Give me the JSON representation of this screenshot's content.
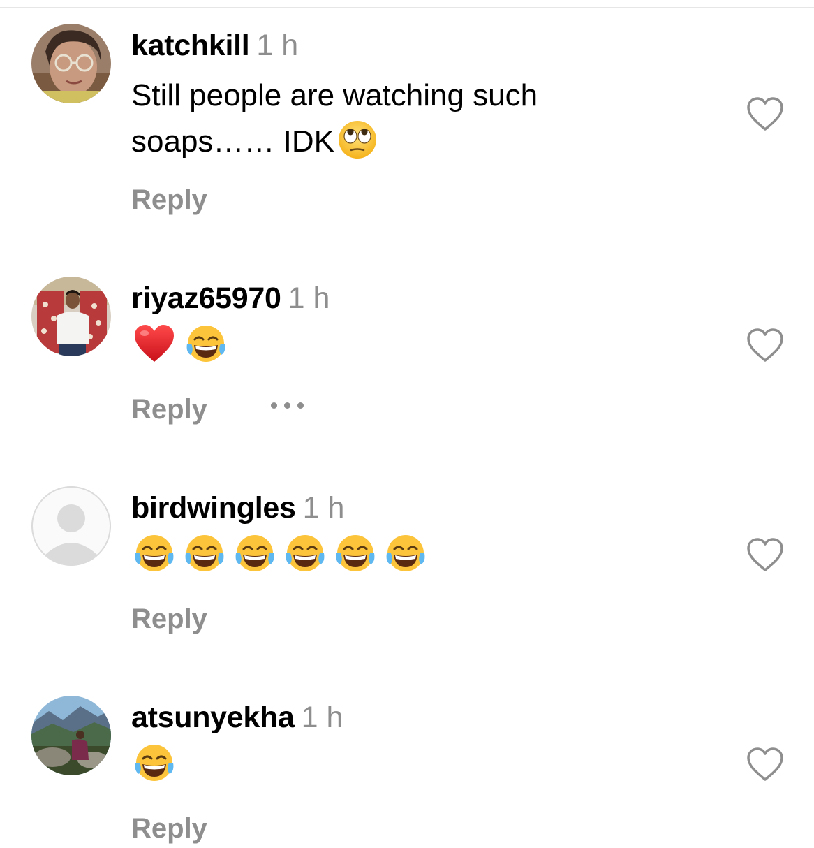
{
  "comments": [
    {
      "username": "katchkill",
      "time": "1 h",
      "text": "Still people are watching such\nsoaps…… IDK",
      "emojis": [
        "face-with-rolling-eyes"
      ],
      "reply_label": "Reply",
      "like_icon": "heart-outline-icon",
      "avatar": "user-photo"
    },
    {
      "username": "riyaz65970",
      "time": "1 h",
      "text": "",
      "emojis": [
        "red-heart",
        "face-with-tears-of-joy"
      ],
      "reply_label": "Reply",
      "more_icon": "more-options-icon",
      "like_icon": "heart-outline-icon",
      "avatar": "user-photo"
    },
    {
      "username": "birdwingles",
      "time": "1 h",
      "text": "",
      "emojis": [
        "face-with-tears-of-joy",
        "face-with-tears-of-joy",
        "face-with-tears-of-joy",
        "face-with-tears-of-joy",
        "face-with-tears-of-joy",
        "face-with-tears-of-joy"
      ],
      "reply_label": "Reply",
      "like_icon": "heart-outline-icon",
      "avatar": "default-avatar"
    },
    {
      "username": "atsunyekha",
      "time": "1 h",
      "text": "",
      "emojis": [
        "face-with-tears-of-joy"
      ],
      "reply_label": "Reply",
      "like_icon": "heart-outline-icon",
      "avatar": "user-photo"
    }
  ],
  "colors": {
    "primary_text": "#000000",
    "secondary_text": "#8e8e8e",
    "divider": "#e6e6e6",
    "heart_red": "#e0141e",
    "emoji_yellow": "#fbc43b"
  }
}
